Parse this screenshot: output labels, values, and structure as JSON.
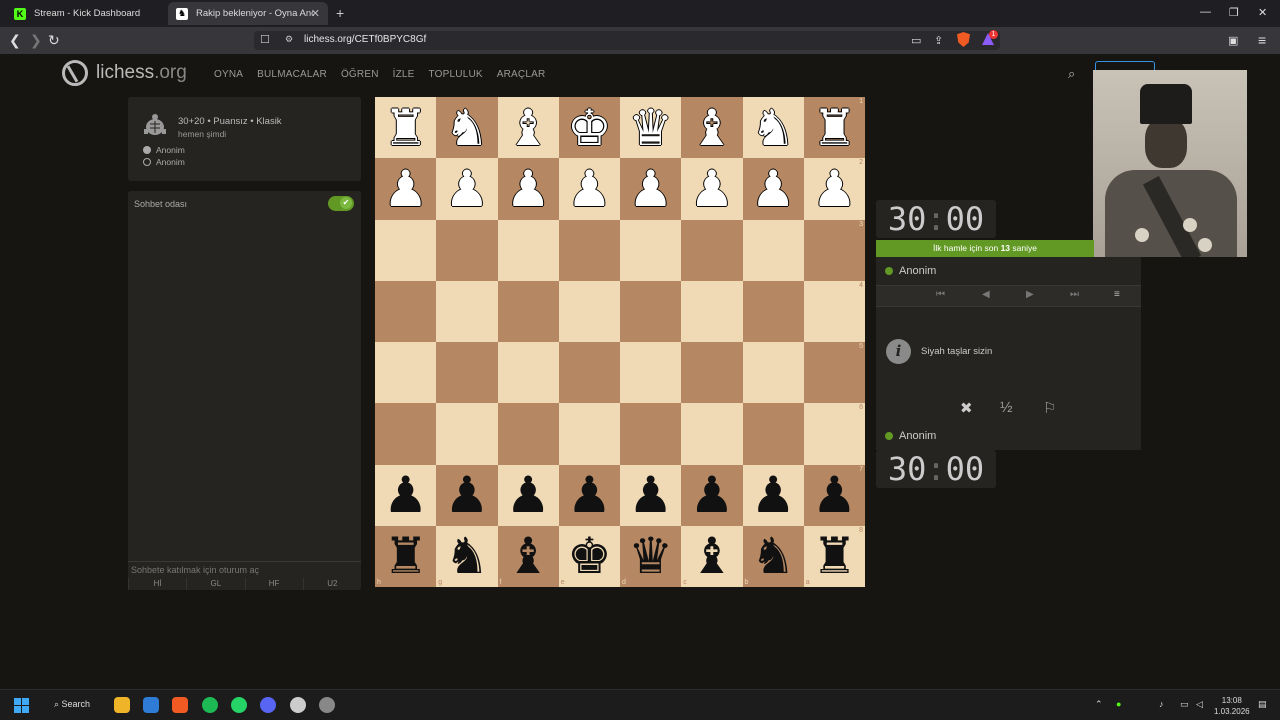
{
  "browser": {
    "tabs": [
      {
        "label": "Stream - Kick Dashboard",
        "icon": "kick-icon",
        "active": false
      },
      {
        "label": "Rakip bekleniyor - Oyna Anon.·",
        "icon": "lichess-icon",
        "active": true
      }
    ],
    "url": "lichess.org/CETf0BPYC8Gf",
    "brave_badge": "1"
  },
  "site": {
    "logo": "lichess",
    "logo_suffix": ".org",
    "nav": [
      "OYNA",
      "BULMACALAR",
      "ÖĞREN",
      "İZLE",
      "TOPLULUK",
      "ARAÇLAR"
    ]
  },
  "game": {
    "mode": "30+20 • Puansız • Klasik",
    "created": "hemen şimdi",
    "players": [
      "Anonim",
      "Anonim"
    ]
  },
  "chat": {
    "title": "Sohbet odası",
    "placeholder": "Sohbete katılmak için oturum aç",
    "presets": [
      "Hİ",
      "GL",
      "HF",
      "U2"
    ]
  },
  "board": {
    "ranks": [
      "1",
      "2",
      "3",
      "4",
      "5",
      "6",
      "7",
      "8"
    ],
    "files": [
      "h",
      "g",
      "f",
      "e",
      "d",
      "c",
      "b",
      "a"
    ],
    "white_back": [
      "♜",
      "♞",
      "♝",
      "♚",
      "♛",
      "♝",
      "♞",
      "♜"
    ],
    "pawn": "♟",
    "black_back": [
      "♜",
      "♞",
      "♝",
      "♚",
      "♛",
      "♝",
      "♞",
      "♜"
    ]
  },
  "clocks": {
    "top": {
      "min": "30",
      "sec": "00"
    },
    "bottom": {
      "min": "30",
      "sec": "00"
    }
  },
  "right": {
    "first_move_prefix": "İlk hamle için son",
    "first_move_seconds": "13",
    "first_move_suffix": "saniye",
    "top_player": "Anonim",
    "bottom_player": "Anonim",
    "info_text": "Siyah taşlar sizin",
    "half": "½"
  },
  "taskbar": {
    "search": "Search",
    "time": "13:08",
    "date": "1.03.2026"
  }
}
